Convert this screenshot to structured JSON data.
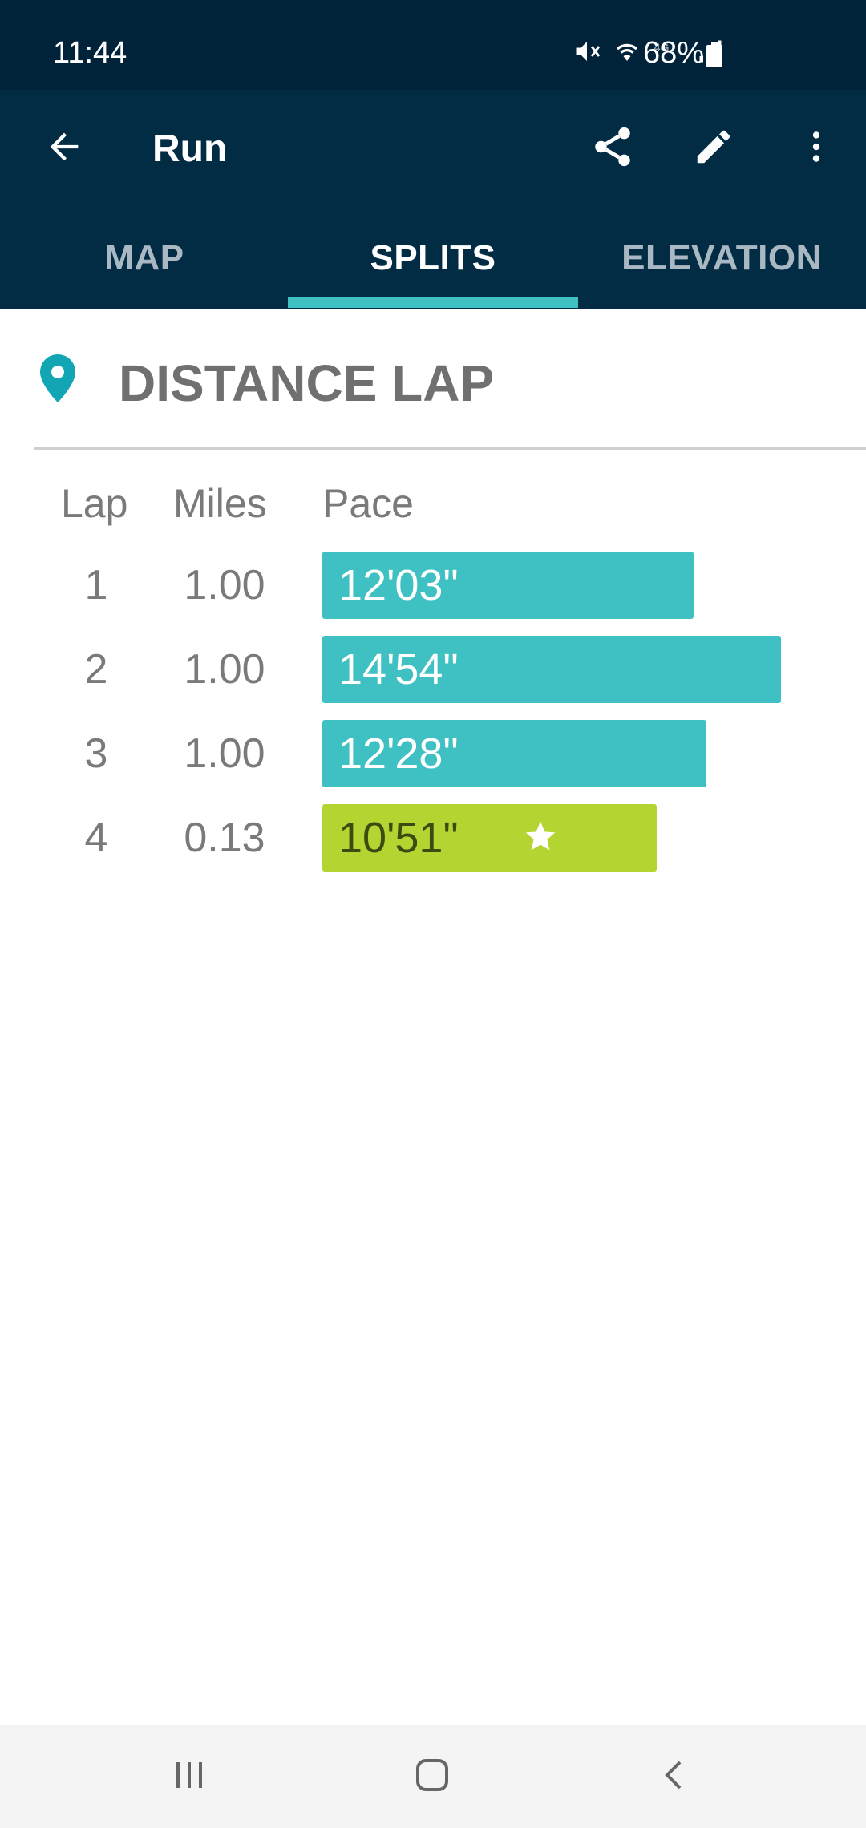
{
  "status_bar": {
    "time": "11:44",
    "battery": "68%",
    "icons": [
      "mute-icon",
      "wifi-icon",
      "4g-icon",
      "signal-icon",
      "battery-icon"
    ]
  },
  "app_bar": {
    "title": "Run",
    "icons": [
      "back-arrow-icon",
      "share-icon",
      "edit-pencil-icon",
      "more-vert-icon"
    ]
  },
  "tabs": [
    {
      "label": "MAP",
      "active": false
    },
    {
      "label": "SPLITS",
      "active": true
    },
    {
      "label": "ELEVATION",
      "active": false
    }
  ],
  "section": {
    "title": "DISTANCE LAP",
    "icon": "location-pin-icon"
  },
  "table": {
    "headers": {
      "lap": "Lap",
      "miles": "Miles",
      "pace": "Pace"
    },
    "rows": [
      {
        "lap": "1",
        "miles": "1.00",
        "pace": "12'03\"",
        "pace_seconds": 723,
        "best": false
      },
      {
        "lap": "2",
        "miles": "1.00",
        "pace": "14'54\"",
        "pace_seconds": 894,
        "best": false
      },
      {
        "lap": "3",
        "miles": "1.00",
        "pace": "12'28\"",
        "pace_seconds": 748,
        "best": false
      },
      {
        "lap": "4",
        "miles": "0.13",
        "pace": "10'51\"",
        "pace_seconds": 651,
        "best": true
      }
    ]
  },
  "colors": {
    "status_bg": "#01233a",
    "appbar_bg": "#022c44",
    "accent": "#3fc1c3",
    "best": "#b4d432"
  },
  "nav_bar": {
    "icons": [
      "recents-icon",
      "home-icon",
      "back-icon"
    ]
  }
}
